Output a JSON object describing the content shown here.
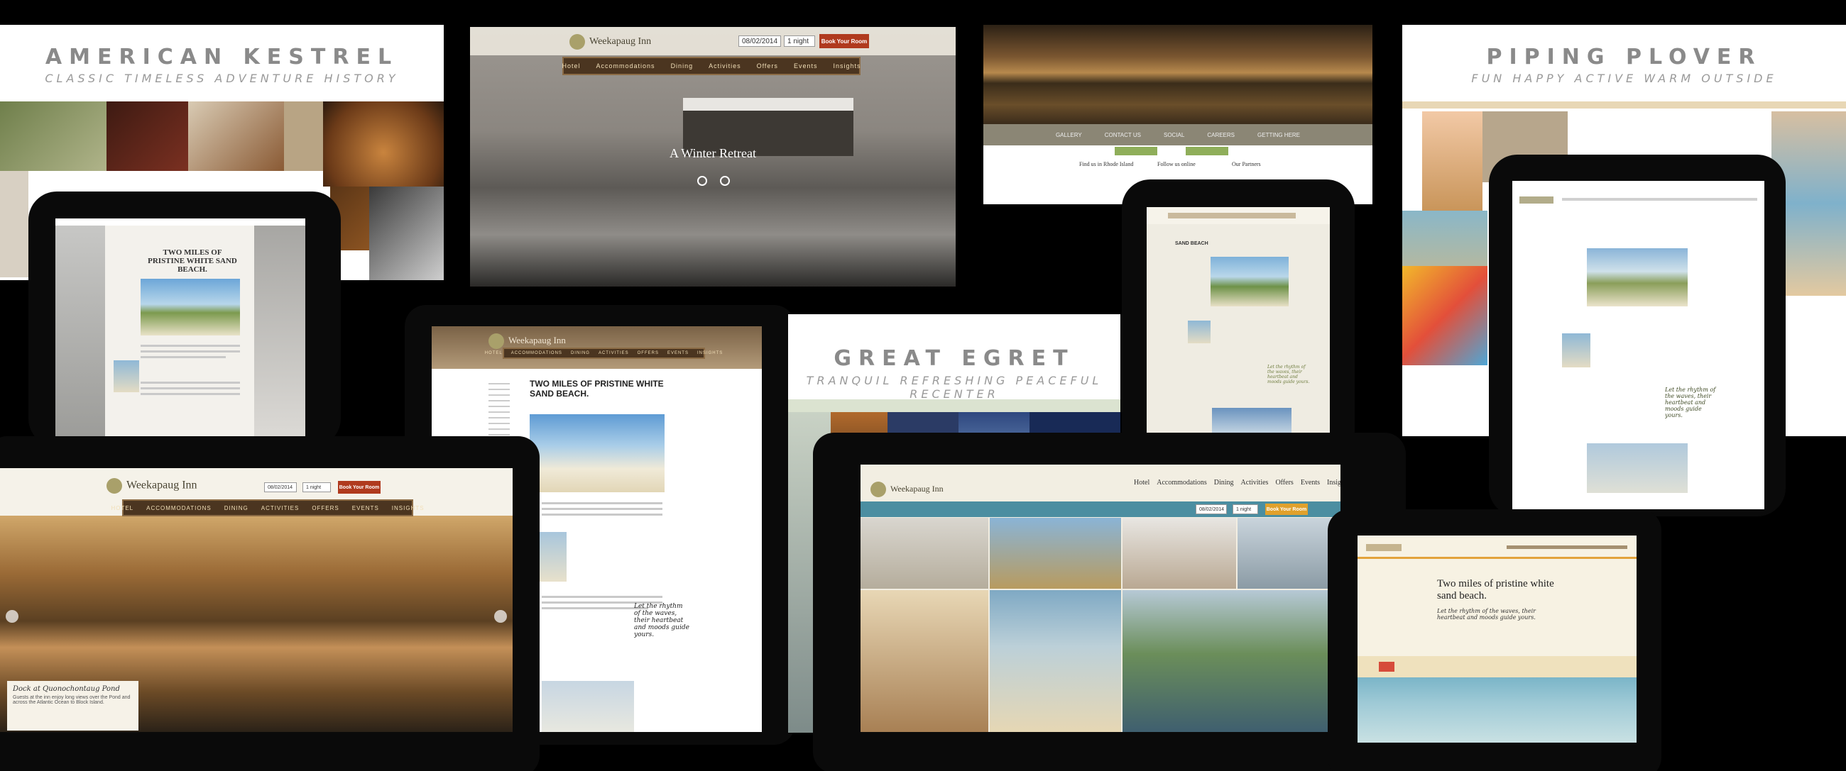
{
  "boards": {
    "kestrel": {
      "title": "AMERICAN KESTREL",
      "words": "CLASSIC  TIMELESS  ADVENTURE  HISTORY"
    },
    "plover": {
      "title": "PIPING PLOVER",
      "words": "FUN  HAPPY  ACTIVE  WARM  OUTSIDE"
    },
    "egret": {
      "title": "GREAT EGRET",
      "words": "TRANQUIL  REFRESHING  PEACEFUL  RECENTER"
    }
  },
  "inn": {
    "logo": "Weekapaug Inn",
    "nav": [
      "Hotel",
      "Accommodations",
      "Dining",
      "Activities",
      "Offers",
      "Events",
      "Insights"
    ],
    "nav_caps": [
      "HOTEL",
      "ACCOMMODATIONS",
      "DINING",
      "ACTIVITIES",
      "OFFERS",
      "EVENTS",
      "INSIGHTS"
    ],
    "book": "Book Your Room",
    "date": "08/02/2014",
    "nights": "1 night"
  },
  "winter": {
    "headline": "A Winter Retreat"
  },
  "beach": {
    "headline_caps": "TWO MILES OF PRISTINE WHITE SAND BEACH.",
    "headline": "Two miles of pristine white sand beach.",
    "quote": "Let the rhythm of the waves, their heartbeat and moods guide yours."
  },
  "dock": {
    "title": "Dock at Quonochontaug Pond",
    "desc": "Guests at the inn enjoy long views over the Pond and across the Atlantic Ocean to Block Island."
  },
  "footer": {
    "find": "Find us in Rhode Island",
    "follow": "Follow us online",
    "partners": "Our Partners",
    "links": [
      "GALLERY",
      "CONTACT US",
      "SOCIAL",
      "CAREERS",
      "GETTING HERE"
    ]
  },
  "sidebar_label": "SAND BEACH"
}
